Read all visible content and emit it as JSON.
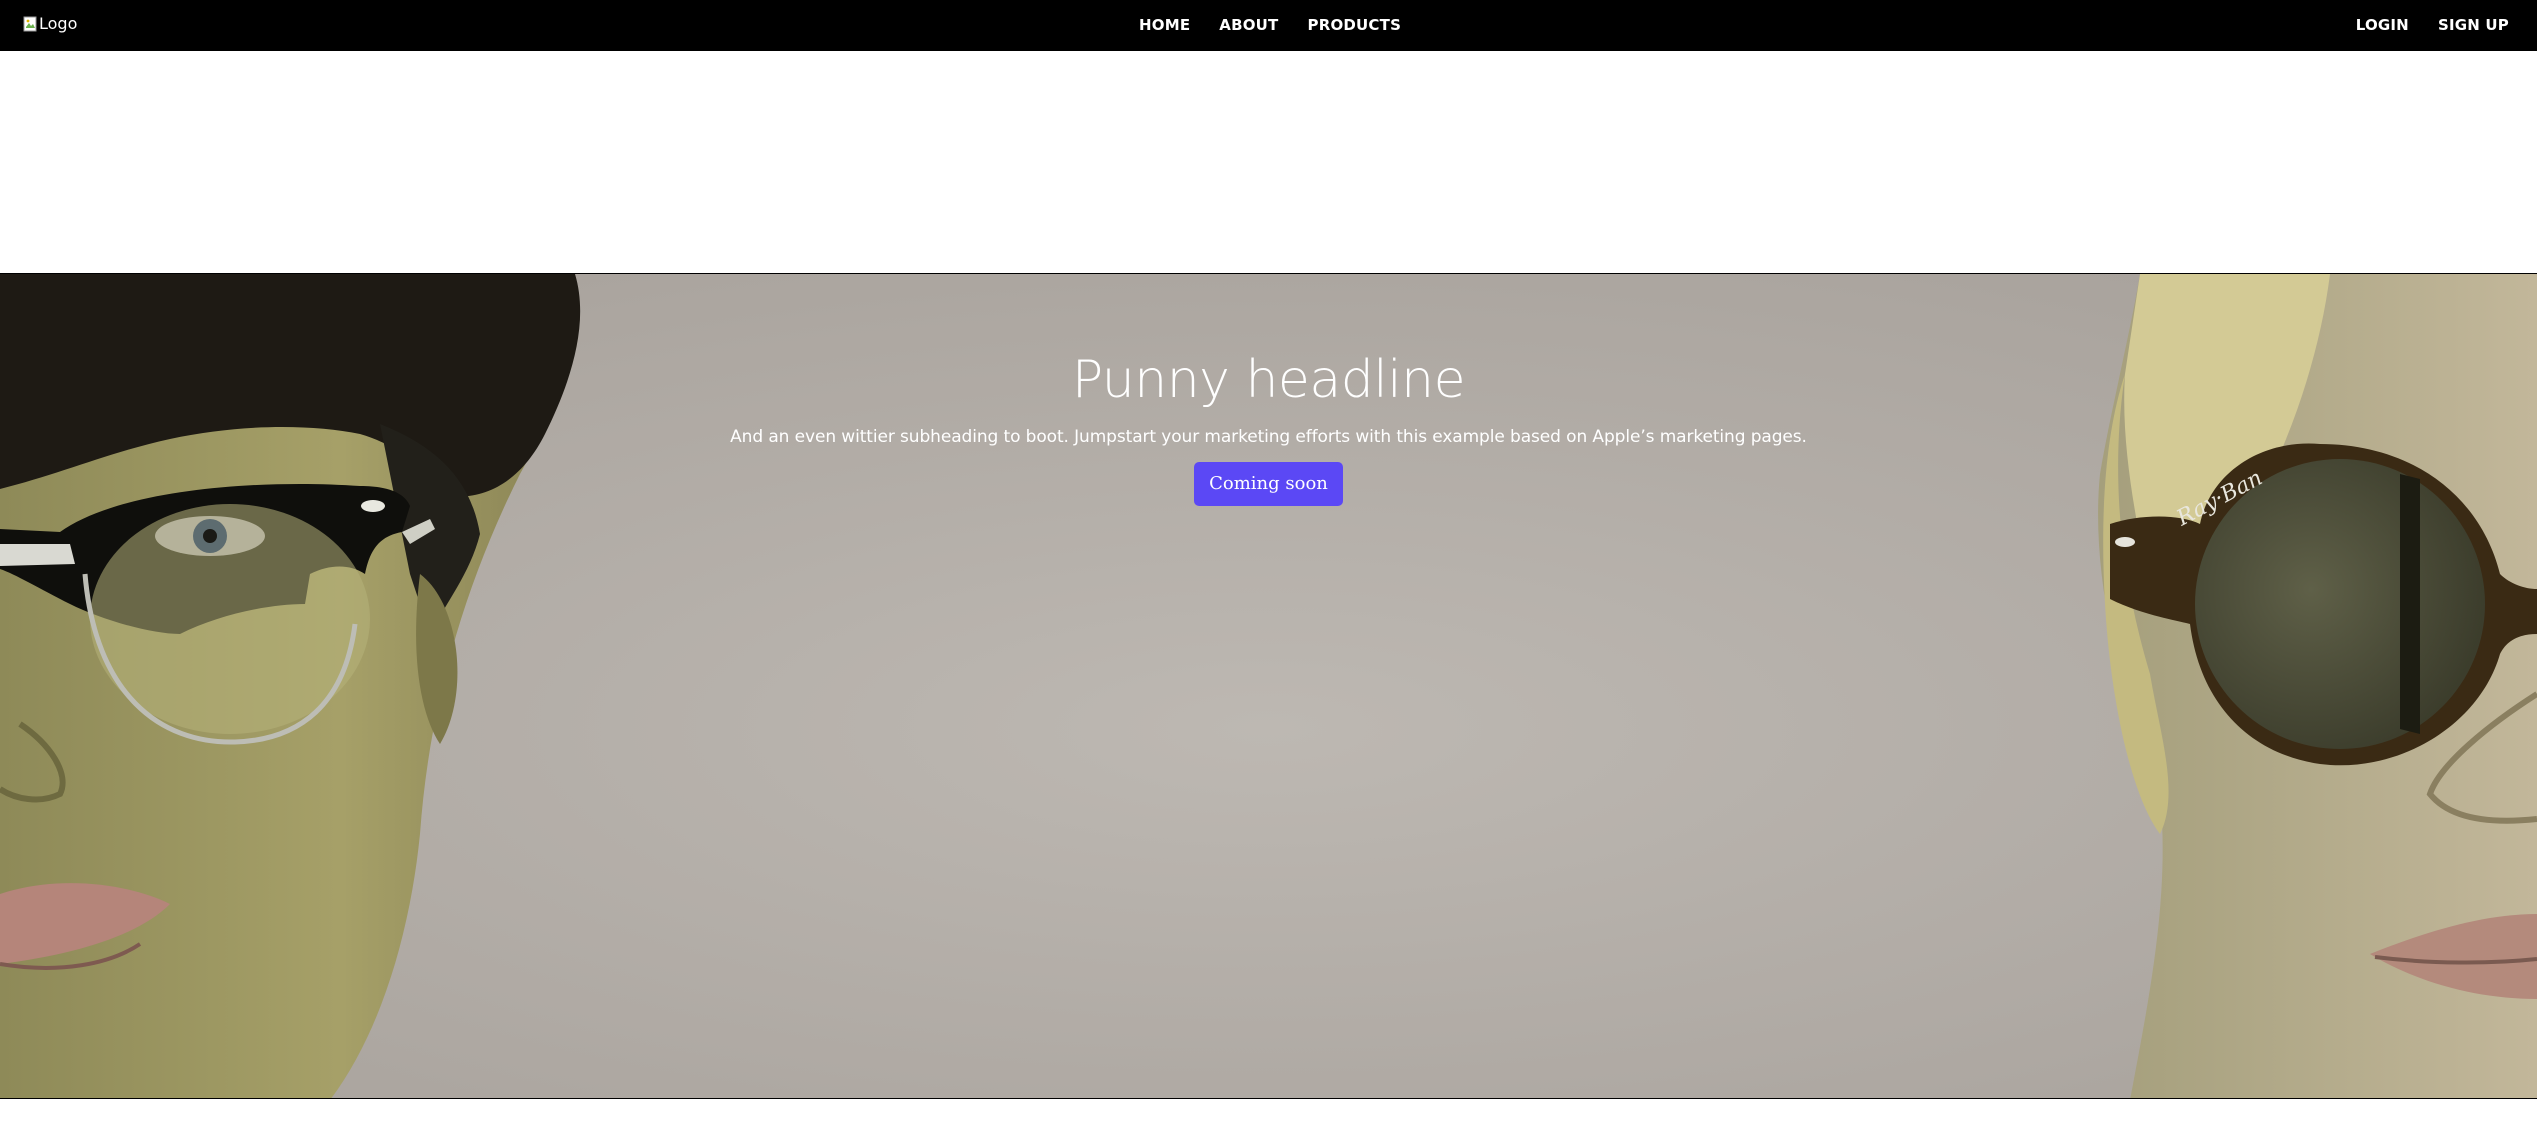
{
  "header": {
    "logo_alt": "Logo",
    "nav_center": [
      {
        "label": "HOME"
      },
      {
        "label": "ABOUT"
      },
      {
        "label": "PRODUCTS"
      }
    ],
    "nav_right": [
      {
        "label": "LOGIN"
      },
      {
        "label": "SIGN UP"
      }
    ]
  },
  "hero": {
    "title": "Punny headline",
    "subtitle": "And an even wittier subheading to boot. Jumpstart your marketing efforts with this example based on Apple’s marketing pages.",
    "button_label": "Coming soon",
    "image_left": "portrait-man-clubmaster-glasses",
    "image_right": "portrait-woman-round-sunglasses",
    "colors": {
      "nav_bg": "#000000",
      "button_bg": "#5b48f5",
      "backdrop": "#b4aea8"
    }
  }
}
